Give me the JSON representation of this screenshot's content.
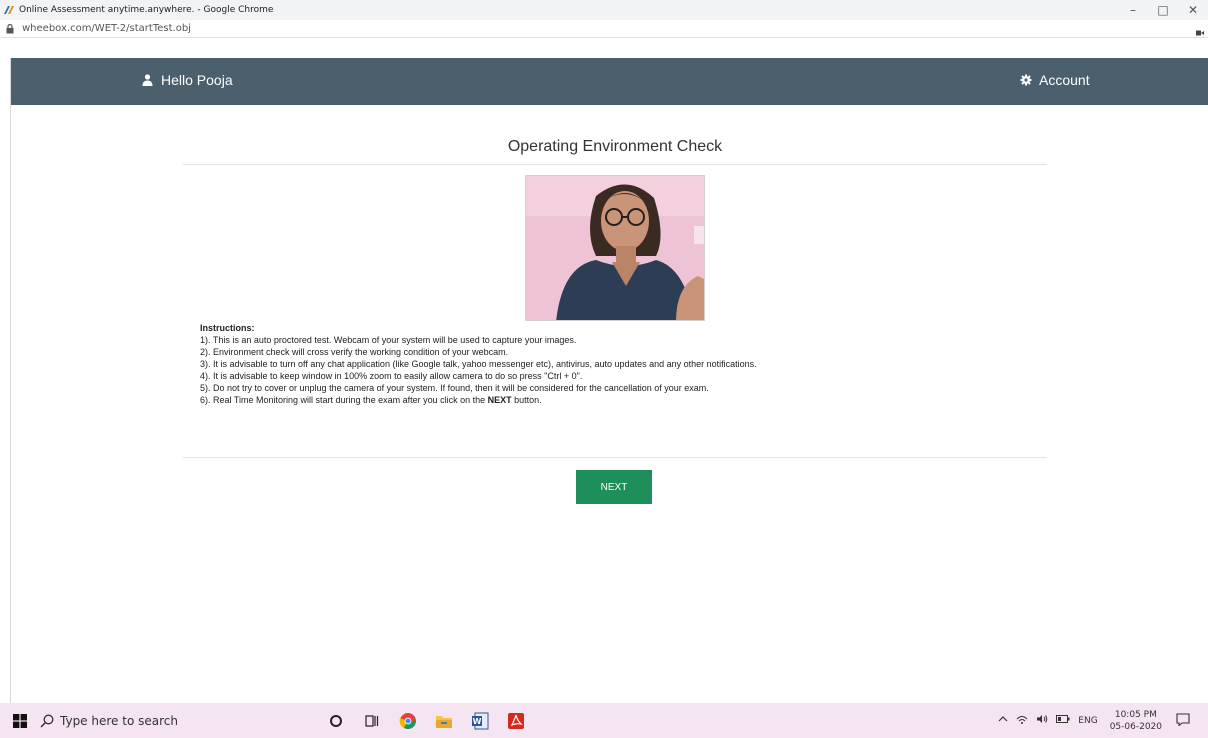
{
  "browser": {
    "window_title": "Online Assessment anytime.anywhere. - Google Chrome",
    "url": "wheebox.com/WET-2/startTest.obj",
    "controls": {
      "minimize": "–",
      "maximize": "□",
      "close": "✕"
    }
  },
  "navbar": {
    "greeting": "Hello Pooja",
    "account_label": "Account",
    "bg_color": "#4b5f6c"
  },
  "main": {
    "heading": "Operating Environment Check",
    "instructions_title": "Instructions:",
    "instructions": [
      "1). This is an auto proctored test. Webcam of your system will be used to capture your images.",
      "2). Environment check will cross verify the working condition of your webcam.",
      "3). It is advisable to turn off any chat application (like Google talk, yahoo messenger etc), antivirus, auto updates and any other notifications.",
      "4). It is advisable to keep window in 100% zoom to easily allow camera to do so press \"Ctrl + 0\".",
      "5). Do not try to cover or unplug the camera of your system. If found, then it will be considered for the cancellation of your exam."
    ],
    "instruction6_pre": "6). Real Time Monitoring will start during the exam after you click on the ",
    "instruction6_bold": "NEXT",
    "instruction6_post": " button.",
    "next_label": "NEXT",
    "next_color": "#1e8e5a"
  },
  "taskbar": {
    "search_placeholder": "Type here to search",
    "language": "ENG",
    "time": "10:05 PM",
    "date": "05-06-2020"
  }
}
